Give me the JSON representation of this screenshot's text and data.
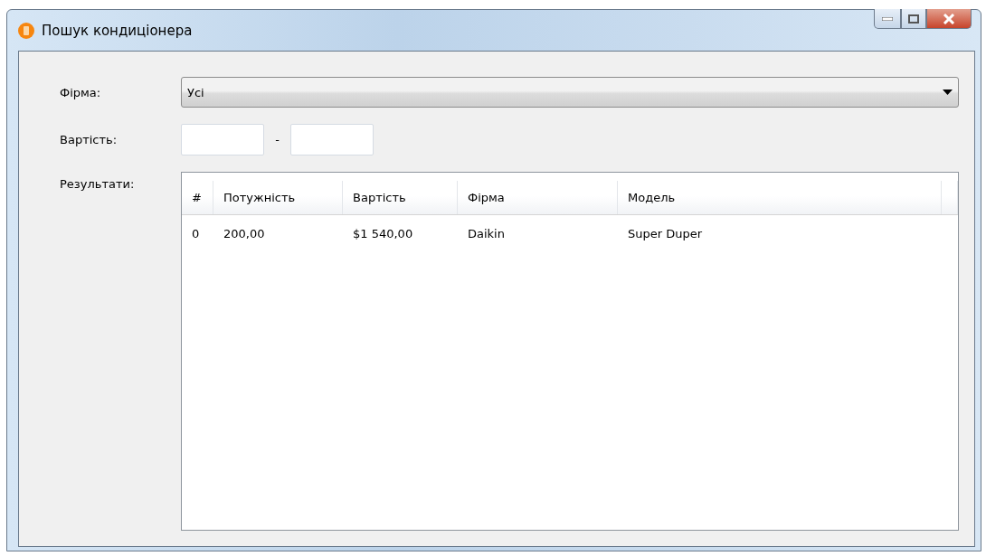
{
  "window": {
    "title": "Пошук кондиціонера"
  },
  "form": {
    "firm_label": "Фірма:",
    "firm_value": "Усі",
    "cost_label": "Вартість:",
    "cost_separator": "-",
    "results_label": "Результати:"
  },
  "table": {
    "columns": [
      "#",
      "Потужність",
      "Вартість",
      "Фірма",
      "Модель"
    ],
    "rows": [
      [
        "0",
        "200,00",
        "$1 540,00",
        "Daikin",
        "Super Duper"
      ]
    ]
  }
}
